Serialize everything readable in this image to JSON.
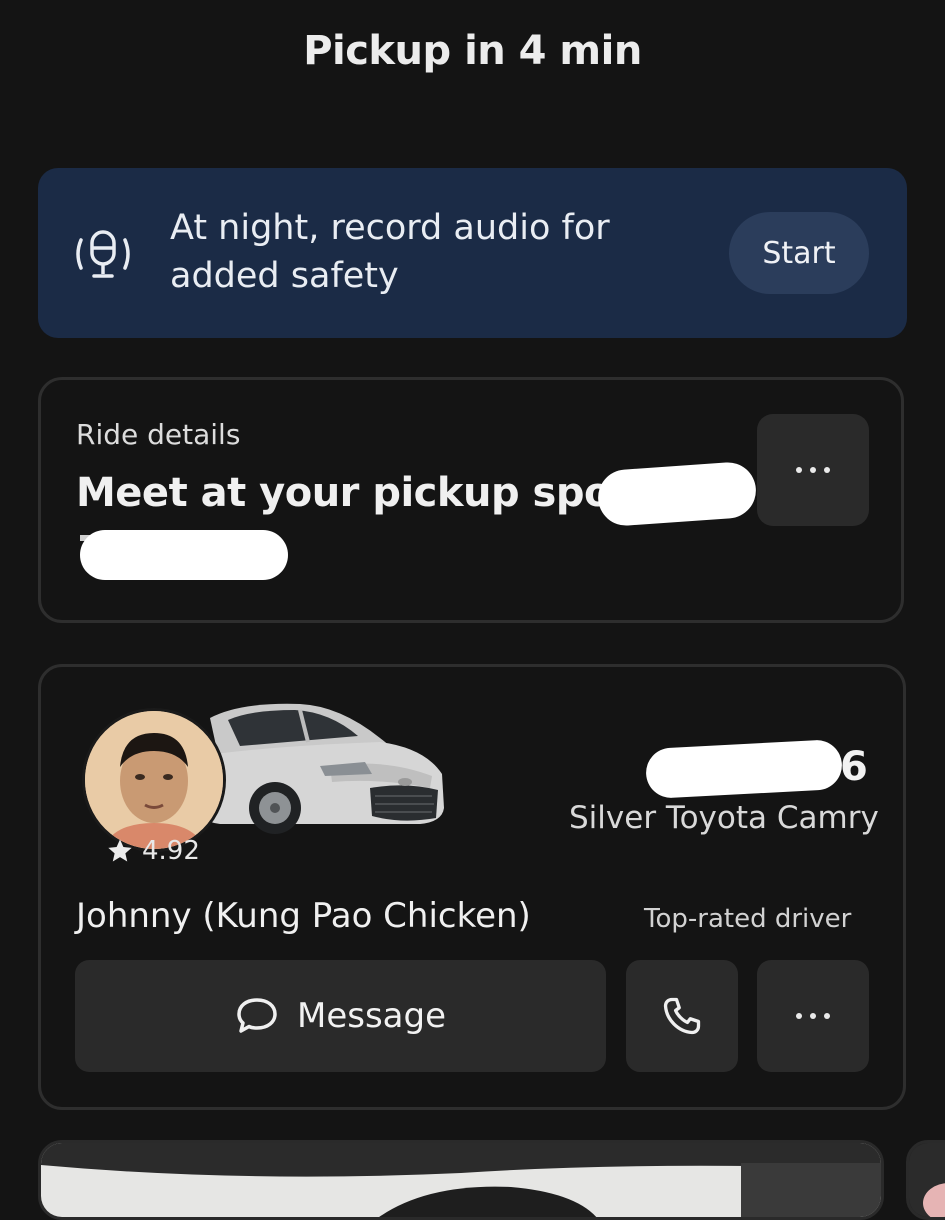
{
  "header": {
    "title": "Pickup in 4 min"
  },
  "safety_banner": {
    "text": "At night, record audio for added safety",
    "start_label": "Start",
    "icon": "record-audio-icon",
    "bg_color": "#1b2b46"
  },
  "ride_details": {
    "label": "Ride details",
    "heading": "Meet at your pickup spot",
    "more_icon": "more-dots-icon"
  },
  "driver": {
    "rating": "4.92",
    "plate_visible": "6",
    "car_model": "Silver Toyota Camry",
    "name": "Johnny (Kung Pao Chicken)",
    "badge": "Top-rated driver",
    "message_label": "Message",
    "message_icon": "chat-bubble-icon",
    "call_icon": "phone-icon",
    "more_icon": "more-dots-icon"
  },
  "colors": {
    "background": "#141414",
    "card": "#2a2a2a",
    "banner": "#1b2b46"
  }
}
